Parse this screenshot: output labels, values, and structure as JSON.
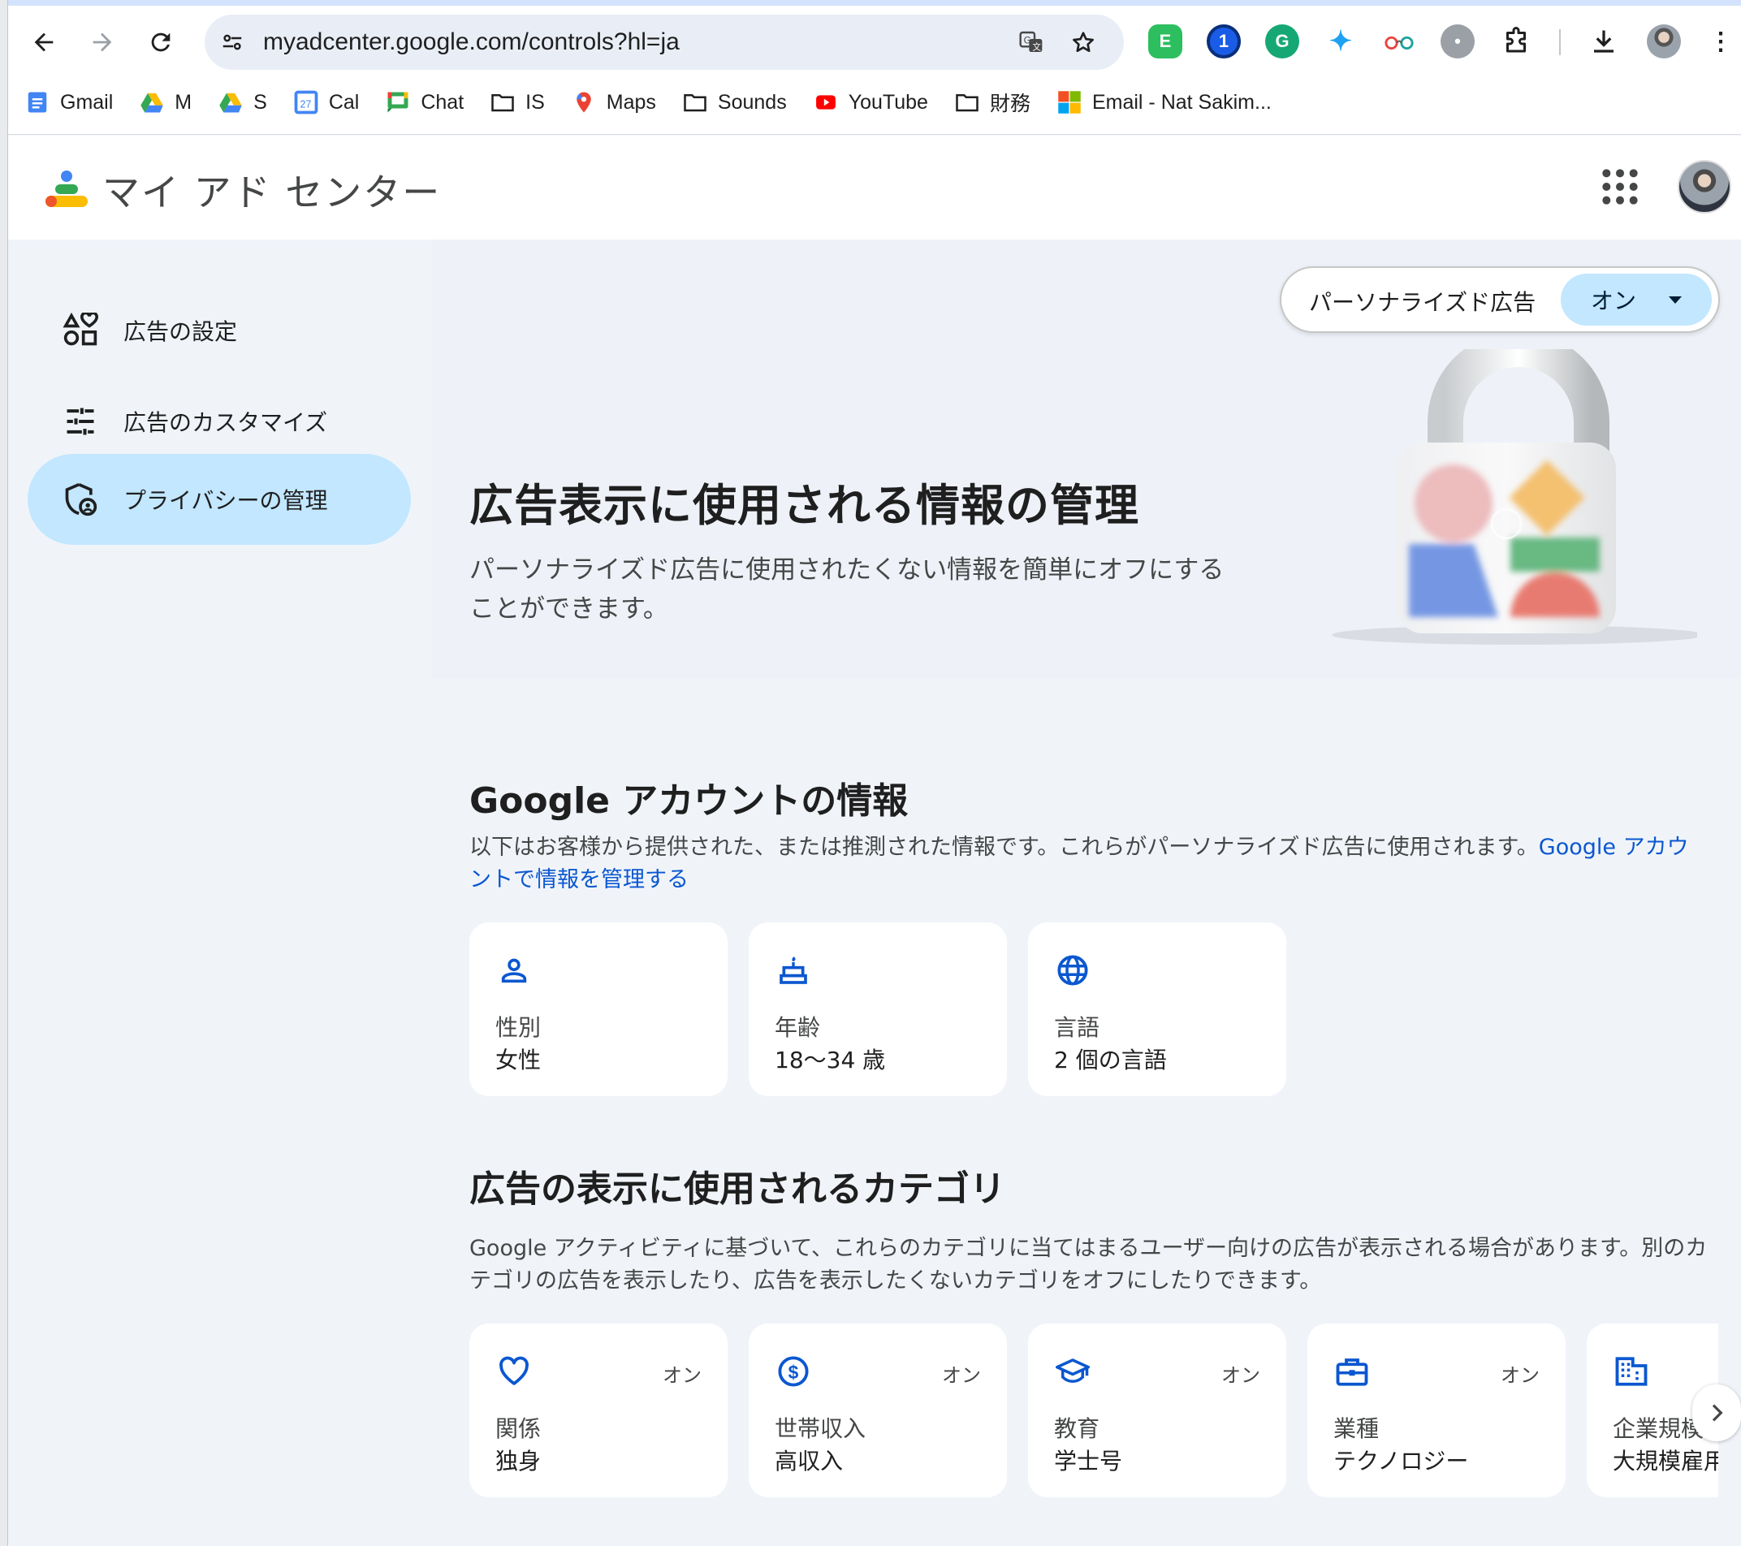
{
  "browser": {
    "url": "myadcenter.google.com/controls?hl=ja",
    "bookmarks": [
      {
        "label": "Gmail",
        "icon": "docs-icon"
      },
      {
        "label": "M",
        "icon": "drive-icon"
      },
      {
        "label": "S",
        "icon": "drive-icon"
      },
      {
        "label": "Cal",
        "icon": "calendar-icon"
      },
      {
        "label": "Chat",
        "icon": "chat-icon"
      },
      {
        "label": "IS",
        "icon": "folder-icon"
      },
      {
        "label": "Maps",
        "icon": "maps-pin-icon"
      },
      {
        "label": "Sounds",
        "icon": "folder-icon"
      },
      {
        "label": "YouTube",
        "icon": "youtube-icon"
      },
      {
        "label": "財務",
        "icon": "folder-icon"
      },
      {
        "label": "Email - Nat Sakim...",
        "icon": "microsoft-icon"
      }
    ]
  },
  "app": {
    "title": "マイ アド センター"
  },
  "sidebar": {
    "items": [
      {
        "label": "広告の設定",
        "icon": "shapes-icon"
      },
      {
        "label": "広告のカスタマイズ",
        "icon": "tune-icon"
      },
      {
        "label": "プライバシーの管理",
        "icon": "privacy-shield-icon"
      }
    ]
  },
  "toggle": {
    "label": "パーソナライズド広告",
    "value": "オン"
  },
  "hero": {
    "title": "広告表示に使用される情報の管理",
    "description": "パーソナライズド広告に使用されたくない情報を簡単にオフにすることができます。"
  },
  "account_section": {
    "title": "Google アカウントの情報",
    "description": "以下はお客様から提供された、または推測された情報です。これらがパーソナライズド広告に使用されます。",
    "link": "Google アカウントで情報を管理する",
    "cards": [
      {
        "label": "性別",
        "value": "女性",
        "icon": "person-icon"
      },
      {
        "label": "年齢",
        "value": "18〜34 歳",
        "icon": "cake-icon"
      },
      {
        "label": "言語",
        "value": "2 個の言語",
        "icon": "globe-icon"
      }
    ]
  },
  "category_section": {
    "title": "広告の表示に使用されるカテゴリ",
    "description": "Google アクティビティに基づいて、これらのカテゴリに当てはまるユーザー向けの広告が表示される場合があります。別のカテゴリの広告を表示したり、広告を表示したくないカテゴリをオフにしたりできます。",
    "cards": [
      {
        "label": "関係",
        "value": "独身",
        "status": "オン",
        "icon": "heart-icon"
      },
      {
        "label": "世帯収入",
        "value": "高収入",
        "status": "オン",
        "icon": "dollar-icon"
      },
      {
        "label": "教育",
        "value": "学士号",
        "status": "オン",
        "icon": "school-icon"
      },
      {
        "label": "業種",
        "value": "テクノロジー",
        "status": "オン",
        "icon": "briefcase-icon"
      },
      {
        "label": "企業規模",
        "value": "大規模雇用",
        "status": "",
        "icon": "building-icon"
      }
    ]
  },
  "colors": {
    "accent": "#0b57d0",
    "active_nav": "#c2e7ff",
    "page_bg": "#f0f4f9"
  }
}
